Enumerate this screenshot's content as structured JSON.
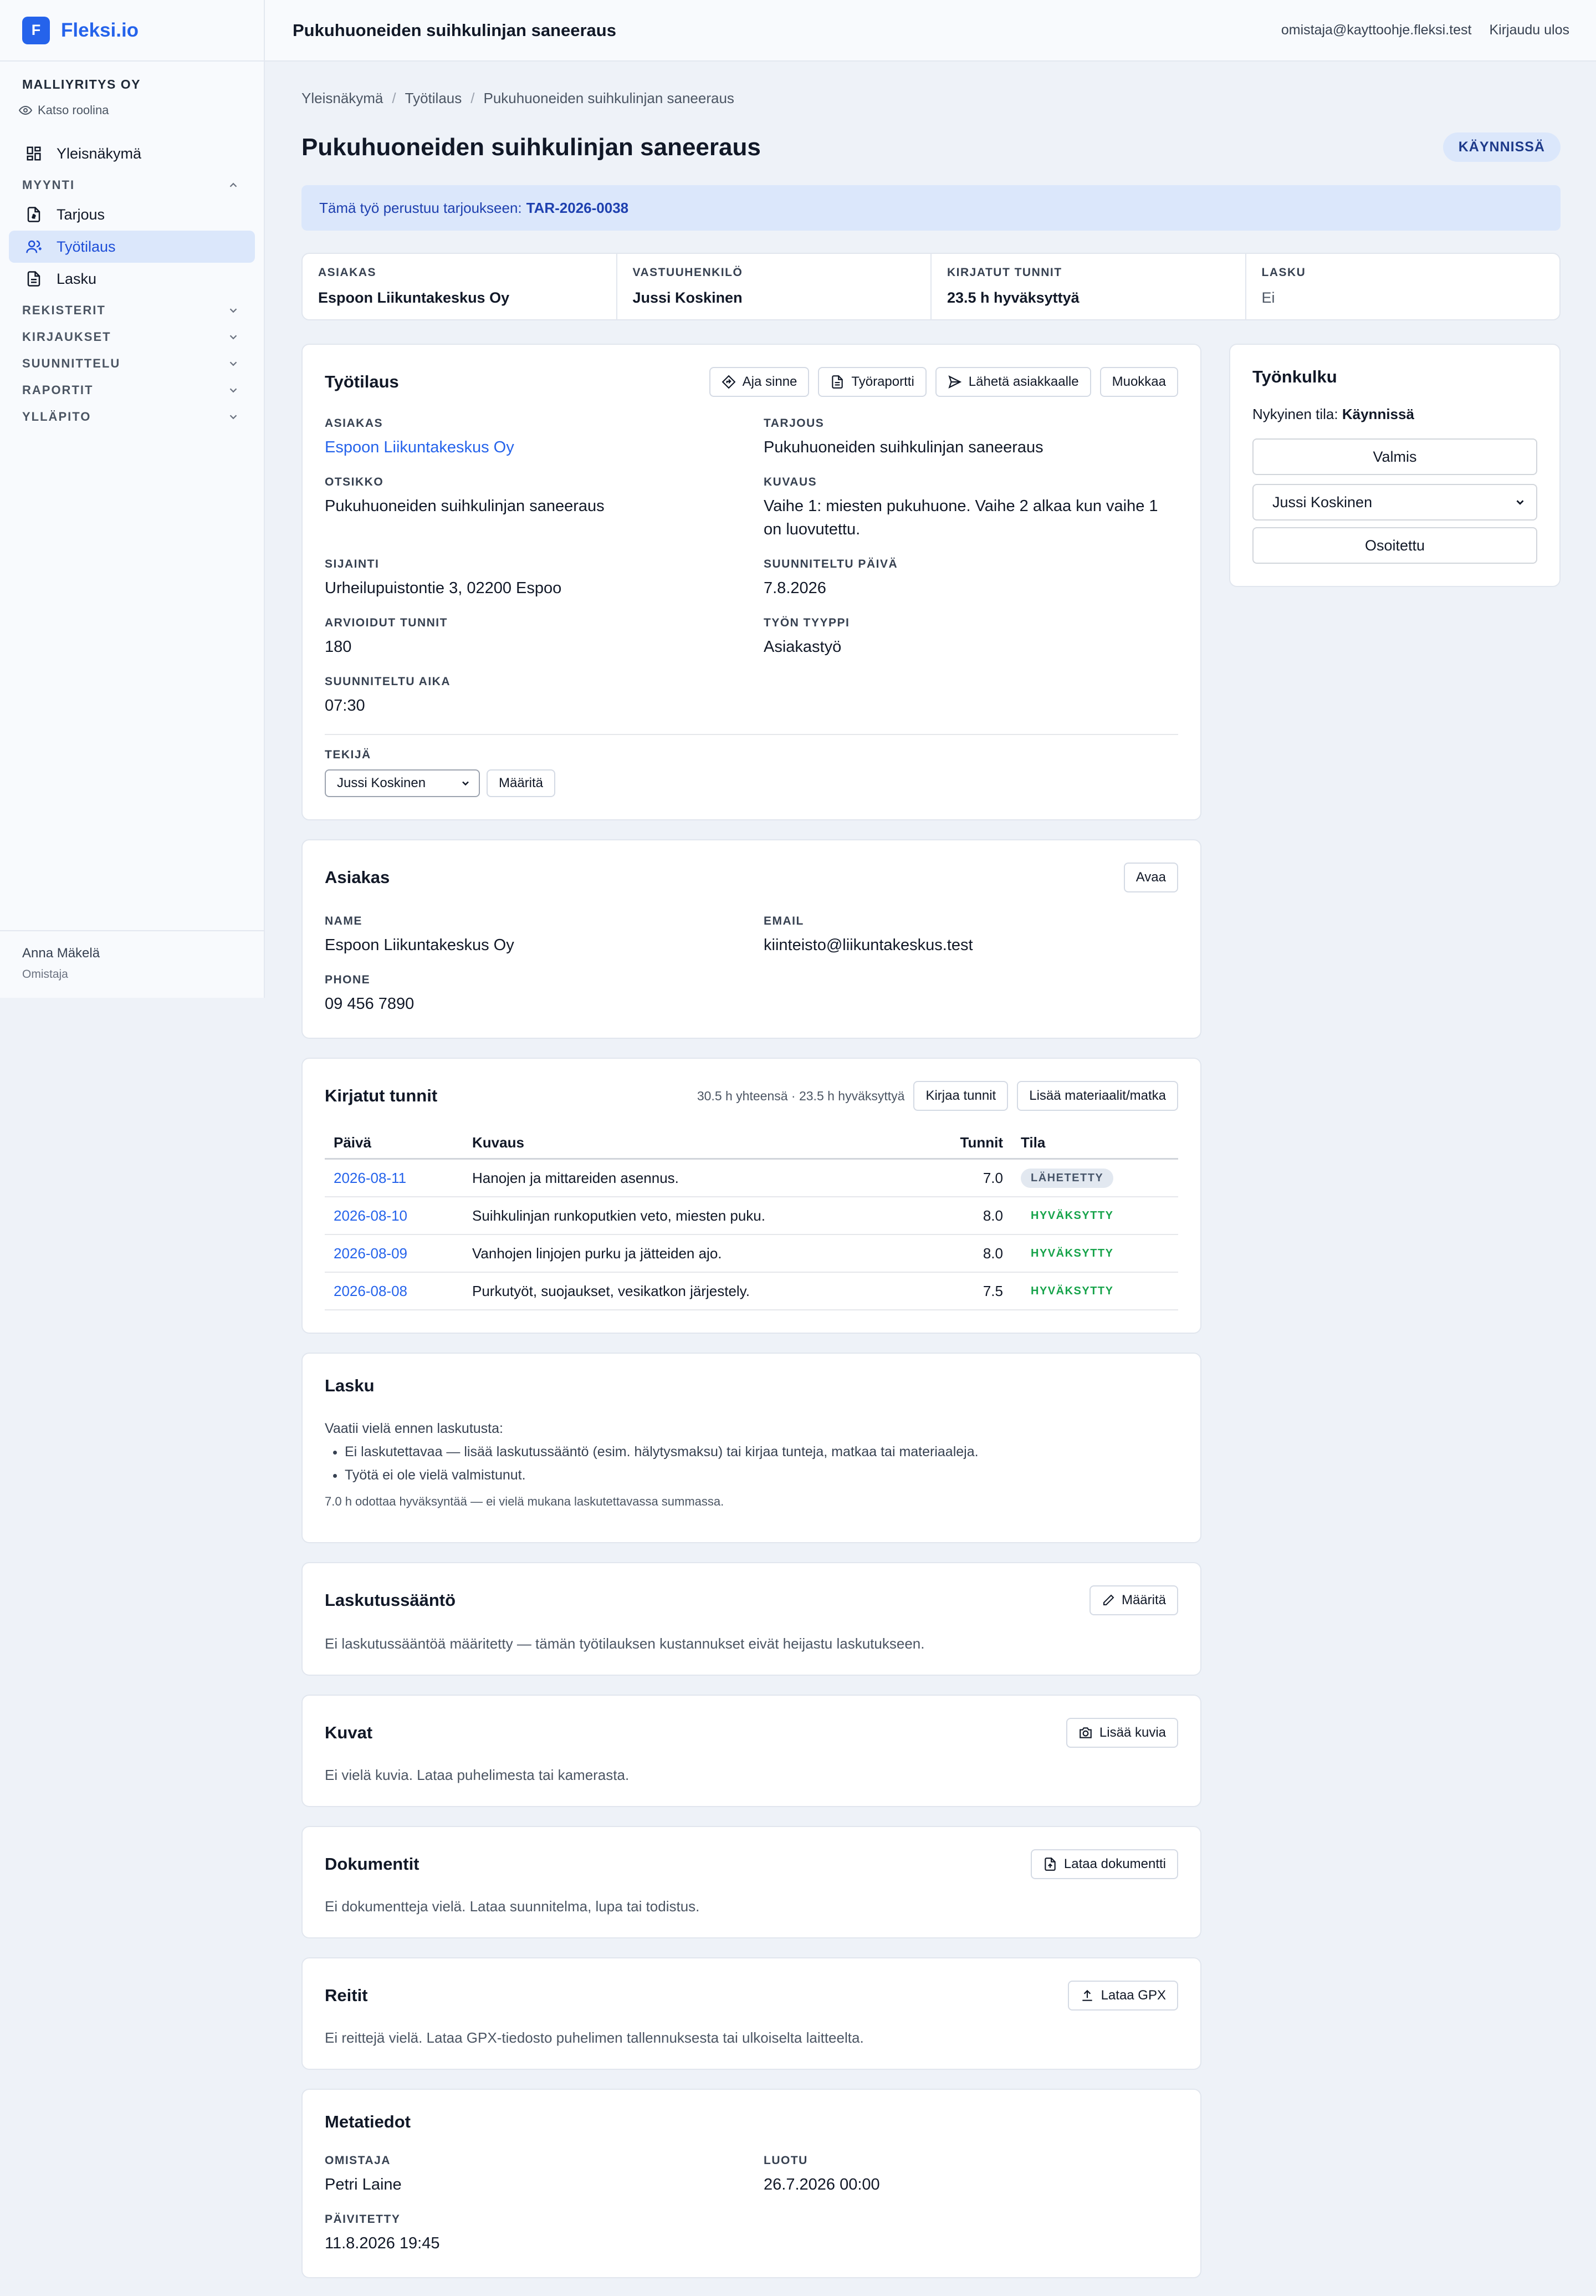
{
  "brand": {
    "logo_letter": "F",
    "name": "Fleksi.io"
  },
  "sidebar": {
    "company": "MALLIYRITYS OY",
    "role_link": "Katso roolina",
    "items": [
      {
        "label": "Yleisnäkymä"
      },
      {
        "label": "Tarjous"
      },
      {
        "label": "Työtilaus"
      },
      {
        "label": "Lasku"
      }
    ],
    "sections": [
      "MYYNTI",
      "REKISTERIT",
      "KIRJAUKSET",
      "SUUNNITTELU",
      "RAPORTIT",
      "YLLÄPITO"
    ],
    "user_name": "Anna Mäkelä",
    "user_role": "Omistaja"
  },
  "topbar": {
    "title": "Pukuhuoneiden suihkulinjan saneeraus",
    "email": "omistaja@kayttoohje.fleksi.test",
    "logout": "Kirjaudu ulos"
  },
  "breadcrumb": [
    "Yleisnäkymä",
    "Työtilaus",
    "Pukuhuoneiden suihkulinjan saneeraus"
  ],
  "page": {
    "title": "Pukuhuoneiden suihkulinjan saneeraus",
    "status": "KÄYNNISSÄ"
  },
  "banner": {
    "text": "Tämä työ perustuu tarjoukseen:",
    "ref": "TAR-2026-0038"
  },
  "summary": [
    {
      "label": "ASIAKAS",
      "value": "Espoon Liikuntakeskus Oy"
    },
    {
      "label": "VASTUUHENKILÖ",
      "value": "Jussi Koskinen"
    },
    {
      "label": "KIRJATUT TUNNIT",
      "value": "23.5 h hyväksyttyä"
    },
    {
      "label": "LASKU",
      "value": "Ei"
    }
  ],
  "work_order": {
    "title": "Työtilaus",
    "buttons": {
      "drive": "Aja sinne",
      "report": "Työraportti",
      "send": "Lähetä asiakkaalle",
      "edit": "Muokkaa"
    },
    "fields": {
      "customer_label": "ASIAKAS",
      "customer": "Espoon Liikuntakeskus Oy",
      "offer_label": "TARJOUS",
      "offer": "Pukuhuoneiden suihkulinjan saneeraus",
      "heading_label": "OTSIKKO",
      "heading": "Pukuhuoneiden suihkulinjan saneeraus",
      "desc_label": "KUVAUS",
      "desc": "Vaihe 1: miesten pukuhuone. Vaihe 2 alkaa kun vaihe 1 on luovutettu.",
      "location_label": "SIJAINTI",
      "location": "Urheilupuistontie 3, 02200 Espoo",
      "planned_date_label": "SUUNNITELTU PÄIVÄ",
      "planned_date": "7.8.2026",
      "est_hours_label": "ARVIOIDUT TUNNIT",
      "est_hours": "180",
      "work_type_label": "TYÖN TYYPPI",
      "work_type": "Asiakastyö",
      "planned_time_label": "SUUNNITELTU AIKA",
      "planned_time": "07:30"
    },
    "worker_label": "TEKIJÄ",
    "worker_selected": "Jussi Koskinen",
    "assign_button": "Määritä"
  },
  "customer_card": {
    "title": "Asiakas",
    "open": "Avaa",
    "name_label": "NAME",
    "name": "Espoon Liikuntakeskus Oy",
    "email_label": "EMAIL",
    "email": "kiinteisto@liikuntakeskus.test",
    "phone_label": "PHONE",
    "phone": "09 456 7890"
  },
  "hours": {
    "title": "Kirjatut tunnit",
    "meta": "30.5 h yhteensä · 23.5 h hyväksyttyä",
    "btn_log": "Kirjaa tunnit",
    "btn_add": "Lisää materiaalit/matka",
    "columns": [
      "Päivä",
      "Kuvaus",
      "Tunnit",
      "Tila"
    ],
    "rows": [
      {
        "date": "2026-08-11",
        "desc": "Hanojen ja mittareiden asennus.",
        "hours": "7.0",
        "status": "LÄHETETTY"
      },
      {
        "date": "2026-08-10",
        "desc": "Suihkulinjan runkoputkien veto, miesten puku.",
        "hours": "8.0",
        "status": "HYVÄKSYTTY"
      },
      {
        "date": "2026-08-09",
        "desc": "Vanhojen linjojen purku ja jätteiden ajo.",
        "hours": "8.0",
        "status": "HYVÄKSYTTY"
      },
      {
        "date": "2026-08-08",
        "desc": "Purkutyöt, suojaukset, vesikatkon järjestely.",
        "hours": "7.5",
        "status": "HYVÄKSYTTY"
      }
    ]
  },
  "invoice": {
    "title": "Lasku",
    "intro": "Vaatii vielä ennen laskutusta:",
    "items": [
      "Ei laskutettavaa — lisää laskutussääntö (esim. hälytysmaksu) tai kirjaa tunteja, matkaa tai materiaaleja.",
      "Työtä ei ole vielä valmistunut."
    ],
    "note": "7.0 h odottaa hyväksyntää — ei vielä mukana laskutettavassa summassa."
  },
  "billing_rule": {
    "title": "Laskutussääntö",
    "button": "Määritä",
    "text": "Ei laskutussääntöä määritetty — tämän työtilauksen kustannukset eivät heijastu laskutukseen."
  },
  "images": {
    "title": "Kuvat",
    "button": "Lisää kuvia",
    "text": "Ei vielä kuvia. Lataa puhelimesta tai kamerasta."
  },
  "documents": {
    "title": "Dokumentit",
    "button": "Lataa dokumentti",
    "text": "Ei dokumentteja vielä. Lataa suunnitelma, lupa tai todistus."
  },
  "routes": {
    "title": "Reitit",
    "button": "Lataa GPX",
    "text": "Ei reittejä vielä. Lataa GPX-tiedosto puhelimen tallennuksesta tai ulkoiselta laitteelta."
  },
  "metadata": {
    "title": "Metatiedot",
    "owner_label": "OMISTAJA",
    "owner": "Petri Laine",
    "created_label": "LUOTU",
    "created": "26.7.2026 00:00",
    "updated_label": "PÄIVITETTY",
    "updated": "11.8.2026 19:45"
  },
  "workflow": {
    "title": "Työnkulku",
    "state_prefix": "Nykyinen tila:",
    "state": "Käynnissä",
    "done_button": "Valmis",
    "assignee": "Jussi Koskinen",
    "assigned_button": "Osoitettu"
  },
  "colors": {
    "accent": "#2563eb",
    "active_bg": "#dbe7fb",
    "success": "#16a34a"
  }
}
